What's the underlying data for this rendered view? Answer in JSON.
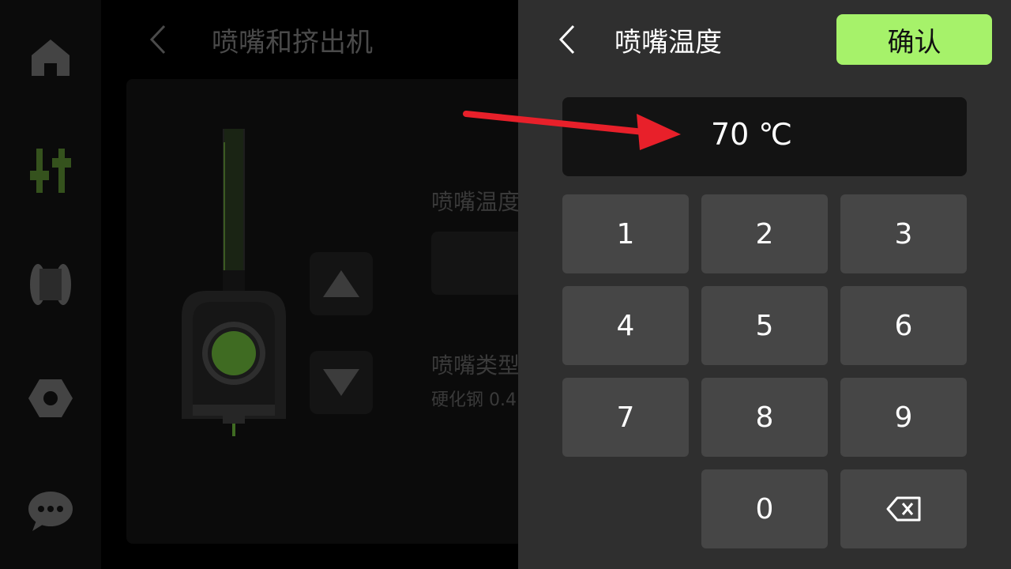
{
  "background_screen": {
    "title": "喷嘴和挤出机",
    "nav_icons": [
      "home-icon",
      "controls-icon",
      "filament-icon",
      "settings-icon",
      "message-icon"
    ],
    "nozzle_temp_label": "喷嘴温度",
    "nozzle_type_label": "喷嘴类型",
    "nozzle_type_value": "硬化钢 0.4"
  },
  "keypad_panel": {
    "title": "喷嘴温度",
    "confirm_label": "确认",
    "display_value": "70 ℃",
    "keys": [
      "1",
      "2",
      "3",
      "4",
      "5",
      "6",
      "7",
      "8",
      "9",
      "0"
    ],
    "backspace_icon": "backspace-icon"
  },
  "colors": {
    "accent_green": "#a6f26a",
    "panel_bg": "#2f2f2f",
    "key_bg": "#464646",
    "display_bg": "#131313",
    "annotation_arrow": "#e8202a"
  }
}
